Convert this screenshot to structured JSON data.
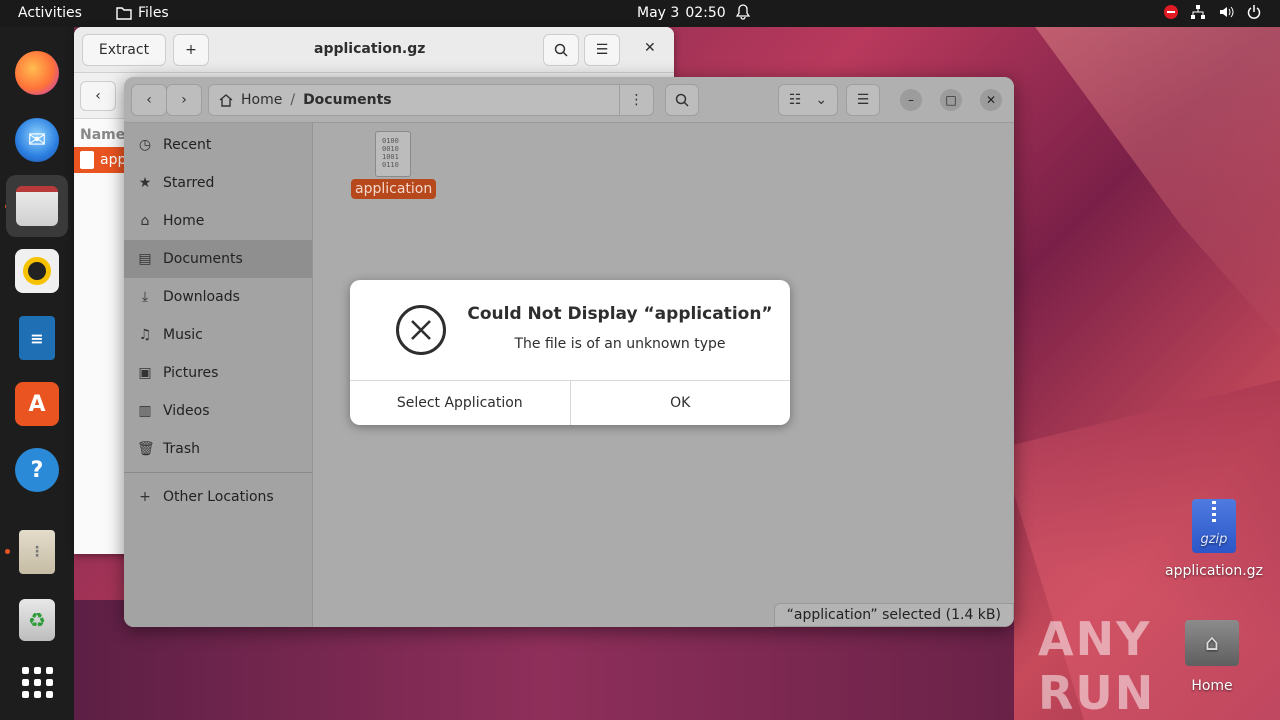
{
  "topbar": {
    "activities": "Activities",
    "app_name": "Files",
    "date": "May 3",
    "time": "02:50"
  },
  "dock": {
    "items": [
      "firefox",
      "thunderbird",
      "files",
      "rhythmbox",
      "libreoffice-writer",
      "app-center",
      "help",
      "archive-manager",
      "trash",
      "show-apps"
    ]
  },
  "archive_window": {
    "extract_label": "Extract",
    "title": "application.gz",
    "column_name": "Name",
    "row_label": "app"
  },
  "files_window": {
    "path": {
      "home": "Home",
      "current": "Documents"
    },
    "sidebar": [
      {
        "label": "Recent",
        "icon": "clock-icon"
      },
      {
        "label": "Starred",
        "icon": "star-icon"
      },
      {
        "label": "Home",
        "icon": "home-icon"
      },
      {
        "label": "Documents",
        "icon": "document-icon"
      },
      {
        "label": "Downloads",
        "icon": "download-icon"
      },
      {
        "label": "Music",
        "icon": "music-icon"
      },
      {
        "label": "Pictures",
        "icon": "picture-icon"
      },
      {
        "label": "Videos",
        "icon": "video-icon"
      },
      {
        "label": "Trash",
        "icon": "trash-icon"
      }
    ],
    "other_locations": "Other Locations",
    "file": {
      "name": "application",
      "binary_lines": [
        "0100",
        "0010",
        "1001",
        "0110"
      ]
    },
    "status": "“application” selected  (1.4 kB)"
  },
  "dialog": {
    "title": "Could Not Display “application”",
    "message": "The file is of an unknown type",
    "select_button": "Select Application",
    "ok_button": "OK"
  },
  "desktop": {
    "gzip_icon_text": "gzip",
    "file_label": "application.gz",
    "home_label": "Home",
    "watermark": "ANY RUN"
  },
  "colors": {
    "accent": "#e95420",
    "selection": "#b7481c"
  }
}
